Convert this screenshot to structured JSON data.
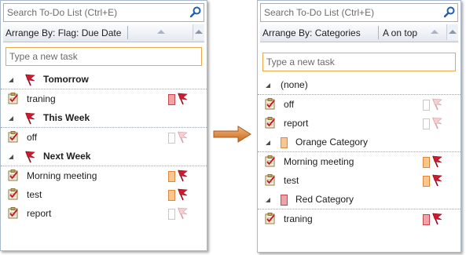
{
  "colors": {
    "accent_flag": "#c8102e",
    "orange_category": "#f8c68e",
    "red_category": "#f0a3a7",
    "new_task_border": "#e9a94a",
    "arrow": "#d8823a"
  },
  "left": {
    "search_placeholder": "Search To-Do List (Ctrl+E)",
    "arrange_label": "Arrange By: Flag: Due Date",
    "new_task_placeholder": "Type a new task",
    "groups": [
      {
        "label": "Tomorrow",
        "tasks": [
          {
            "title": "traning",
            "category": "red",
            "flag": "red"
          }
        ]
      },
      {
        "label": "This Week",
        "tasks": [
          {
            "title": "off",
            "category": "none",
            "flag": "pale"
          }
        ]
      },
      {
        "label": "Next Week",
        "tasks": [
          {
            "title": "Morning meeting",
            "category": "orange",
            "flag": "red"
          },
          {
            "title": "test",
            "category": "orange",
            "flag": "red"
          },
          {
            "title": "report",
            "category": "none",
            "flag": "pale"
          }
        ]
      }
    ]
  },
  "right": {
    "search_placeholder": "Search To-Do List (Ctrl+E)",
    "arrange_label": "Arrange By: Categories",
    "sort_label": "A on top",
    "new_task_placeholder": "Type a new task",
    "groups": [
      {
        "label": "(none)",
        "category": "none",
        "tasks": [
          {
            "title": "off",
            "category": "none",
            "flag": "pale"
          },
          {
            "title": "report",
            "category": "none",
            "flag": "pale"
          }
        ]
      },
      {
        "label": "Orange Category",
        "category": "orange",
        "tasks": [
          {
            "title": "Morning meeting",
            "category": "orange",
            "flag": "red"
          },
          {
            "title": "test",
            "category": "orange",
            "flag": "red"
          }
        ]
      },
      {
        "label": "Red Category",
        "category": "red",
        "tasks": [
          {
            "title": "traning",
            "category": "red",
            "flag": "red"
          }
        ]
      }
    ]
  },
  "icons": {
    "search": "magnifier-icon",
    "task": "task-icon",
    "flag": "flag-icon",
    "expand": "collapse-triangle-icon",
    "arrow": "right-arrow-icon"
  }
}
